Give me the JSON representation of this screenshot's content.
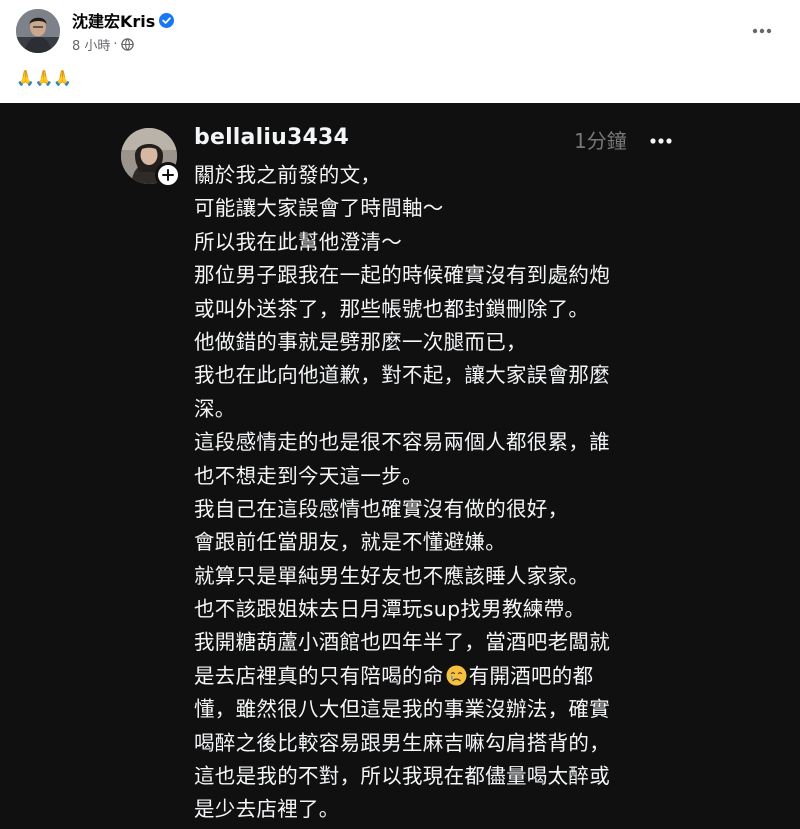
{
  "post": {
    "author_name": "沈建宏Kris",
    "time": "8 小時",
    "separator": "·",
    "caption": "🙏🙏🙏"
  },
  "threads": {
    "username": "bellaliu3434",
    "time": "1分鐘",
    "lines": [
      "關於我之前發的文，",
      "可能讓大家誤會了時間軸～",
      "所以我在此幫他澄清～",
      "那位男子跟我在一起的時候確實沒有到處約炮",
      "或叫外送茶了，那些帳號也都封鎖刪除了。",
      "他做錯的事就是劈那麼一次腿而已，",
      "我也在此向他道歉，對不起，讓大家誤會那麼",
      "深。",
      "這段感情走的也是很不容易兩個人都很累，誰",
      "也不想走到今天這一步。",
      "我自己在這段感情也確實沒有做的很好，",
      "會跟前任當朋友，就是不懂避嫌。",
      "就算只是單純男生好友也不應該睡人家家。",
      "也不該跟姐妹去日月潭玩sup找男教練帶。",
      "我開糖葫蘆小酒館也四年半了，當酒吧老闆就"
    ],
    "line_emoji_before": "是去店裡真的只有陪喝的命",
    "line_emoji_after": "有開酒吧的都",
    "lines_after": [
      "懂，雖然很八大但這是我的事業沒辦法，確實",
      "喝醉之後比較容易跟男生麻吉嘛勾肩搭背的，",
      "這也是我的不對，所以我現在都儘量喝太醉或",
      "是少去店裡了。"
    ]
  },
  "icons": {
    "verified": "verified-badge-icon",
    "globe": "globe-icon",
    "more": "more-dots-icon",
    "plus": "plus-icon",
    "emoji": "crying-face-emoji"
  },
  "colors": {
    "fb_verified": "#1877f2",
    "threads_bg": "#101010",
    "threads_text": "#f3f5f7",
    "threads_meta": "#777777"
  }
}
